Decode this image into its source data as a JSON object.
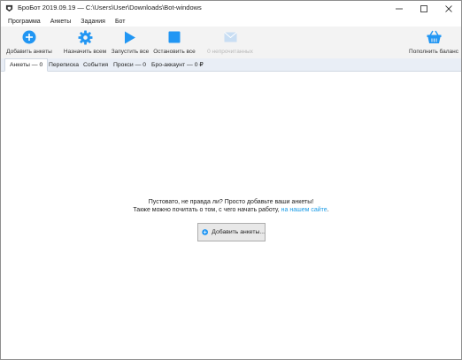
{
  "window": {
    "title": "БроБот 2019.09.19 — C:\\Users\\User\\Downloads\\Bot-windows",
    "controls": {
      "minimize": "minimize-icon",
      "maximize": "maximize-icon",
      "close": "close-icon"
    }
  },
  "menu": {
    "items": [
      {
        "label": "Программа"
      },
      {
        "label": "Анкеты"
      },
      {
        "label": "Задания"
      },
      {
        "label": "Бот"
      }
    ]
  },
  "toolbar": {
    "add": {
      "label": "Добавить анкеты",
      "icon": "plus-circle-icon"
    },
    "assign": {
      "label": "Назначить всем",
      "icon": "gear-icon"
    },
    "start": {
      "label": "Запустить все",
      "icon": "play-icon"
    },
    "stop": {
      "label": "Остановить все",
      "icon": "stop-icon"
    },
    "unread": {
      "label": "0 непрочитанных",
      "icon": "mail-icon",
      "disabled": true
    },
    "balance": {
      "label": "Пополнить баланс",
      "icon": "basket-icon"
    }
  },
  "tabs": [
    {
      "label": "Анкеты — 0",
      "active": true
    },
    {
      "label": "Переписка",
      "active": false
    },
    {
      "label": "События",
      "active": false
    },
    {
      "label": "Прокси — 0",
      "active": false
    },
    {
      "label": "Бро-аккаунт — 0 ₽",
      "active": false
    }
  ],
  "empty_state": {
    "line1": "Пустовато, не правда ли? Просто добавьте ваши анкеты!",
    "line2_prefix": "Также можно почитать о том, с чего начать работу,",
    "line2_link": "на нашем сайте",
    "line2_suffix": ".",
    "button_label": "Добавить анкеты..."
  },
  "colors": {
    "accent": "#2196f3",
    "link": "#1a9be6",
    "toolbar_bg": "#f3f3f3",
    "tabs_bg": "#e9eef6"
  }
}
